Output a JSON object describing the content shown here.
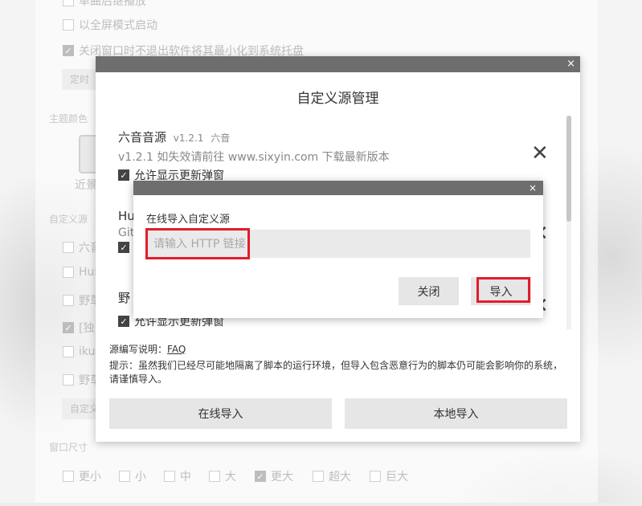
{
  "background": {
    "checks": [
      {
        "label": "单曲后继播放",
        "checked": false
      },
      {
        "label": "以全屏模式启动",
        "checked": false
      },
      {
        "label": "关闭窗口时不退出软件将其最小化到系统托盘",
        "checked": true
      }
    ],
    "timer_btn": "定时",
    "theme_label": "主题颜色",
    "theme_tile_label": "近景",
    "custom_source_label": "自定义源",
    "source_rows": [
      {
        "label": "六音",
        "checked": false
      },
      {
        "label": "Hui",
        "checked": false
      },
      {
        "label": "野草",
        "checked": false
      },
      {
        "label": "[独",
        "checked": true
      },
      {
        "label": "iku",
        "checked": false
      },
      {
        "label": "野草",
        "checked": false
      }
    ],
    "custom_btn": "自定义",
    "window_size_label": "窗口尺寸",
    "sizes": [
      {
        "label": "更小",
        "checked": false
      },
      {
        "label": "小",
        "checked": false
      },
      {
        "label": "中",
        "checked": false
      },
      {
        "label": "大",
        "checked": false
      },
      {
        "label": "更大",
        "checked": true
      },
      {
        "label": "超大",
        "checked": false
      },
      {
        "label": "巨大",
        "checked": false
      }
    ]
  },
  "dialog": {
    "close_glyph": "×",
    "title": "自定义源管理",
    "sources": [
      {
        "name": "六音音源",
        "version": "v1.2.1",
        "author": "六音",
        "desc": "v1.2.1 如失效请前往 www.sixyin.com 下载最新版本",
        "allow_label": "允许显示更新弹窗",
        "checked": true
      },
      {
        "name": "Hu",
        "version": "",
        "author": "",
        "desc": "Git",
        "allow_label": "",
        "checked": true
      },
      {
        "name": "野",
        "version": "",
        "author": "",
        "desc": "",
        "allow_label": "允许显示更新弹窗",
        "checked": true
      }
    ],
    "remove_glyph": "✕",
    "faq_label": "源编写说明：",
    "faq_link": "FAQ",
    "hint": "提示：虽然我们已经尽可能地隔离了脚本的运行环境，但导入包含恶意行为的脚本仍可能会影响你的系统，请谨慎导入。",
    "online_import": "在线导入",
    "local_import": "本地导入"
  },
  "import_dialog": {
    "close_glyph": "×",
    "label": "在线导入自定义源",
    "placeholder": "请输入 HTTP 链接",
    "close_btn": "关闭",
    "import_btn": "导入"
  },
  "highlight_color": "#e11d2a"
}
